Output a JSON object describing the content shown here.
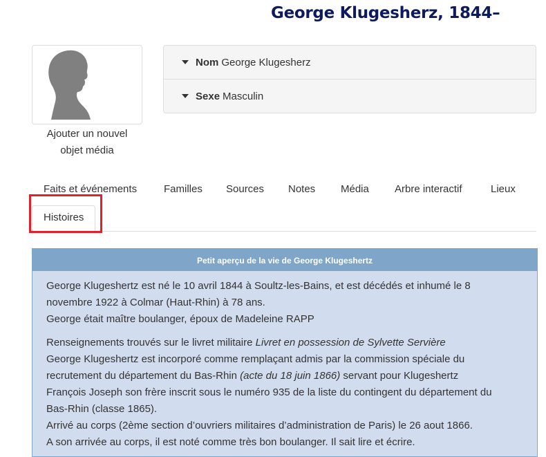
{
  "person": {
    "title": "George Klugesherz, 1844–"
  },
  "media": {
    "caption_line1": "Ajouter un nouvel",
    "caption_line2": "objet média",
    "icon": "silhouette-icon"
  },
  "facts": [
    {
      "label": "Nom",
      "value": "George Klugesherz"
    },
    {
      "label": "Sexe",
      "value": "Masculin"
    }
  ],
  "tabs": [
    {
      "label": "Faits et événements"
    },
    {
      "label": "Familles"
    },
    {
      "label": "Sources"
    },
    {
      "label": "Notes"
    },
    {
      "label": "Média"
    },
    {
      "label": "Arbre interactif"
    },
    {
      "label": "Lieux"
    },
    {
      "label": "Histoires",
      "active": true
    }
  ],
  "colors": {
    "title": "#0d1a5e",
    "panel_header": "#7fa6c9",
    "panel_body": "#d1dcee",
    "highlight": "#e0202a"
  },
  "story": {
    "heading": "Petit aperçu de la vie de George Klugeshertz",
    "p1_l1": "George Klugeshertz est né le 10 avril 1844 à Soultz-les-Bains, et est décédés et inhumé le 8",
    "p1_l2": "novembre 1922 à Colmar (Haut-Rhin) à 78 ans.",
    "p1_l3": "George était maître boulanger, époux de Madeleine RAPP",
    "p2_l1_a": "Renseignements trouvés sur le livret militaire ",
    "p2_l1_b": "Livret en possession de Sylvette Servière",
    "p2_l2": "George Klugeshertz est incorporé comme remplaçant admis par la commission spéciale du",
    "p2_l3_a": "recrutement du département du Bas-Rhin ",
    "p2_l3_b": "(acte du 18 juin 1866)",
    "p2_l3_c": " servant pour Klugeshertz",
    "p2_l4": "François Joseph son frère inscrit sous le numéro 935 de la liste du contingent du département du",
    "p2_l5": "Bas-Rhin (classe 1865).",
    "p2_l6": "Arrivé au corps (2ème section d’ouvriers militaires d’administration de Paris) le 26 aout 1866.",
    "p2_l7": "A son arrivée au corps, il est noté comme très bon boulanger. Il sait lire et écrire."
  }
}
